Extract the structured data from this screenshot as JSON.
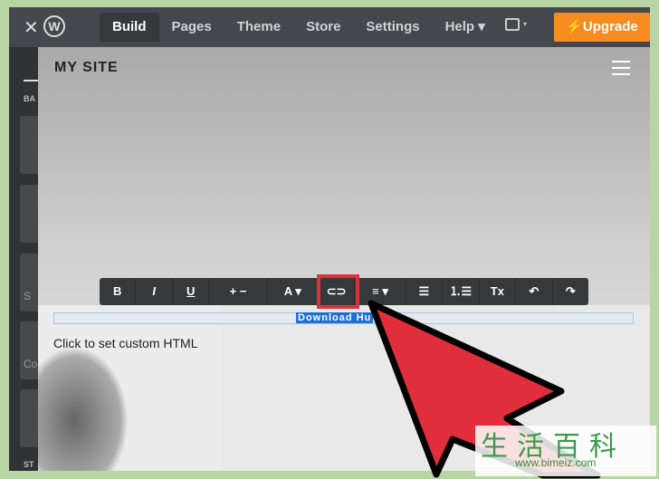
{
  "topbar": {
    "close": "✕",
    "logo": "W",
    "nav": [
      "Build",
      "Pages",
      "Theme",
      "Store",
      "Settings",
      "Help ▾"
    ],
    "active": "Build",
    "device_caret": "▾",
    "upgrade": "⚡Upgrade"
  },
  "sidebar": {
    "section1": "BA",
    "tile3": "S",
    "tile4": "Co",
    "section2": "ST"
  },
  "site": {
    "title": "MY SITE",
    "selected_text": "Download Hu",
    "placeholder": "Click to set custom HTML"
  },
  "toolbar": [
    "B",
    "I",
    "U",
    "+  −",
    "A ▾",
    "⊂⊃",
    "≡ ▾",
    "☰",
    "⒈☰",
    "Tx",
    "↶",
    "↷"
  ],
  "watermark": {
    "chars": "生活百科",
    "url": "www.bimeiz.com"
  },
  "colors": {
    "accent": "#f68b1f",
    "highlight": "#e0303a",
    "selection": "#1f6fd6"
  }
}
